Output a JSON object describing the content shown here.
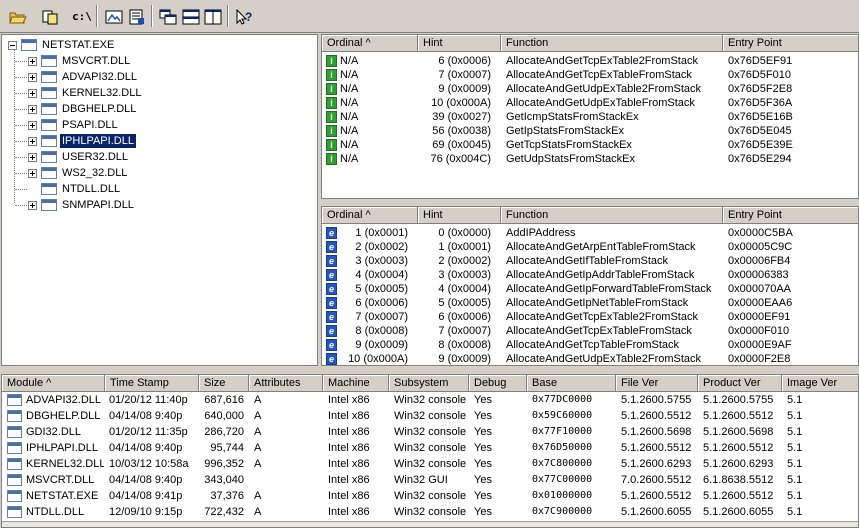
{
  "toolbar": {
    "buttons": [
      "open-icon",
      "copy-icon",
      "fullpath-icon",
      "undecorate-icon",
      "properties-icon",
      "cascade-icon",
      "tile-horizontal-icon",
      "tile-vertical-icon",
      "help-icon"
    ],
    "path_label": "c:\\"
  },
  "tree": {
    "root": "NETSTAT.EXE",
    "children": [
      {
        "label": "MSVCRT.DLL",
        "expandable": true,
        "selected": false
      },
      {
        "label": "ADVAPI32.DLL",
        "expandable": true,
        "selected": false
      },
      {
        "label": "KERNEL32.DLL",
        "expandable": true,
        "selected": false
      },
      {
        "label": "DBGHELP.DLL",
        "expandable": true,
        "selected": false
      },
      {
        "label": "PSAPI.DLL",
        "expandable": true,
        "selected": false
      },
      {
        "label": "IPHLPAPI.DLL",
        "expandable": true,
        "selected": true
      },
      {
        "label": "USER32.DLL",
        "expandable": true,
        "selected": false
      },
      {
        "label": "WS2_32.DLL",
        "expandable": true,
        "selected": false
      },
      {
        "label": "NTDLL.DLL",
        "expandable": false,
        "selected": false
      },
      {
        "label": "SNMPAPI.DLL",
        "expandable": true,
        "selected": false
      }
    ]
  },
  "imports": {
    "headers": [
      "Ordinal ^",
      "Hint",
      "Function",
      "Entry Point"
    ],
    "icon": "i",
    "rows": [
      {
        "ordinal": "N/A",
        "hint": "6  (0x0006)",
        "function": "AllocateAndGetTcpExTable2FromStack",
        "entry": "0x76D5EF91"
      },
      {
        "ordinal": "N/A",
        "hint": "7  (0x0007)",
        "function": "AllocateAndGetTcpExTableFromStack",
        "entry": "0x76D5F010"
      },
      {
        "ordinal": "N/A",
        "hint": "9  (0x0009)",
        "function": "AllocateAndGetUdpExTable2FromStack",
        "entry": "0x76D5F2E8"
      },
      {
        "ordinal": "N/A",
        "hint": "10  (0x000A)",
        "function": "AllocateAndGetUdpExTableFromStack",
        "entry": "0x76D5F36A"
      },
      {
        "ordinal": "N/A",
        "hint": "39  (0x0027)",
        "function": "GetIcmpStatsFromStackEx",
        "entry": "0x76D5E16B"
      },
      {
        "ordinal": "N/A",
        "hint": "56  (0x0038)",
        "function": "GetIpStatsFromStackEx",
        "entry": "0x76D5E045"
      },
      {
        "ordinal": "N/A",
        "hint": "69  (0x0045)",
        "function": "GetTcpStatsFromStackEx",
        "entry": "0x76D5E39E"
      },
      {
        "ordinal": "N/A",
        "hint": "76  (0x004C)",
        "function": "GetUdpStatsFromStackEx",
        "entry": "0x76D5E294"
      }
    ]
  },
  "exports": {
    "headers": [
      "Ordinal ^",
      "Hint",
      "Function",
      "Entry Point"
    ],
    "icon": "e",
    "rows": [
      {
        "ordinal": "1  (0x0001)",
        "hint": "0  (0x0000)",
        "function": "AddIPAddress",
        "entry": "0x0000C5BA"
      },
      {
        "ordinal": "2  (0x0002)",
        "hint": "1  (0x0001)",
        "function": "AllocateAndGetArpEntTableFromStack",
        "entry": "0x00005C9C"
      },
      {
        "ordinal": "3  (0x0003)",
        "hint": "2  (0x0002)",
        "function": "AllocateAndGetIfTableFromStack",
        "entry": "0x00006FB4"
      },
      {
        "ordinal": "4  (0x0004)",
        "hint": "3  (0x0003)",
        "function": "AllocateAndGetIpAddrTableFromStack",
        "entry": "0x00006383"
      },
      {
        "ordinal": "5  (0x0005)",
        "hint": "4  (0x0004)",
        "function": "AllocateAndGetIpForwardTableFromStack",
        "entry": "0x000070AA"
      },
      {
        "ordinal": "6  (0x0006)",
        "hint": "5  (0x0005)",
        "function": "AllocateAndGetIpNetTableFromStack",
        "entry": "0x0000EAA6"
      },
      {
        "ordinal": "7  (0x0007)",
        "hint": "6  (0x0006)",
        "function": "AllocateAndGetTcpExTable2FromStack",
        "entry": "0x0000EF91"
      },
      {
        "ordinal": "8  (0x0008)",
        "hint": "7  (0x0007)",
        "function": "AllocateAndGetTcpExTableFromStack",
        "entry": "0x0000F010"
      },
      {
        "ordinal": "9  (0x0009)",
        "hint": "8  (0x0008)",
        "function": "AllocateAndGetTcpTableFromStack",
        "entry": "0x0000E9AF"
      },
      {
        "ordinal": "10  (0x000A)",
        "hint": "9  (0x0009)",
        "function": "AllocateAndGetUdpExTable2FromStack",
        "entry": "0x0000F2E8"
      }
    ]
  },
  "modules": {
    "headers": [
      "Module ^",
      "Time Stamp",
      "Size",
      "Attributes",
      "Machine",
      "Subsystem",
      "Debug",
      "Base",
      "File Ver",
      "Product Ver",
      "Image Ver"
    ],
    "rows": [
      {
        "module": "ADVAPI32.DLL",
        "time": "01/20/12  11:40p",
        "size": "687,616",
        "attr": "A",
        "machine": "Intel x86",
        "subsystem": "Win32 console",
        "debug": "Yes",
        "base": "0x77DC0000",
        "filever": "5.1.2600.5755",
        "productver": "5.1.2600.5755",
        "imagever": "5.1"
      },
      {
        "module": "DBGHELP.DLL",
        "time": "04/14/08  9:40p",
        "size": "640,000",
        "attr": "A",
        "machine": "Intel x86",
        "subsystem": "Win32 console",
        "debug": "Yes",
        "base": "0x59C60000",
        "filever": "5.1.2600.5512",
        "productver": "5.1.2600.5512",
        "imagever": "5.1"
      },
      {
        "module": "GDI32.DLL",
        "time": "01/20/12  11:35p",
        "size": "286,720",
        "attr": "A",
        "machine": "Intel x86",
        "subsystem": "Win32 console",
        "debug": "Yes",
        "base": "0x77F10000",
        "filever": "5.1.2600.5698",
        "productver": "5.1.2600.5698",
        "imagever": "5.1"
      },
      {
        "module": "IPHLPAPI.DLL",
        "time": "04/14/08  9:40p",
        "size": "95,744",
        "attr": "A",
        "machine": "Intel x86",
        "subsystem": "Win32 console",
        "debug": "Yes",
        "base": "0x76D50000",
        "filever": "5.1.2600.5512",
        "productver": "5.1.2600.5512",
        "imagever": "5.1"
      },
      {
        "module": "KERNEL32.DLL",
        "time": "10/03/12  10:58a",
        "size": "996,352",
        "attr": "A",
        "machine": "Intel x86",
        "subsystem": "Win32 console",
        "debug": "Yes",
        "base": "0x7C800000",
        "filever": "5.1.2600.6293",
        "productver": "5.1.2600.6293",
        "imagever": "5.1"
      },
      {
        "module": "MSVCRT.DLL",
        "time": "04/14/08  9:40p",
        "size": "343,040",
        "attr": "",
        "machine": "Intel x86",
        "subsystem": "Win32 GUI",
        "debug": "Yes",
        "base": "0x77C00000",
        "filever": "7.0.2600.5512",
        "productver": "6.1.8638.5512",
        "imagever": "5.1"
      },
      {
        "module": "NETSTAT.EXE",
        "time": "04/14/08  9:41p",
        "size": "37,376",
        "attr": "A",
        "machine": "Intel x86",
        "subsystem": "Win32 console",
        "debug": "Yes",
        "base": "0x01000000",
        "filever": "5.1.2600.5512",
        "productver": "5.1.2600.5512",
        "imagever": "5.1"
      },
      {
        "module": "NTDLL.DLL",
        "time": "12/09/10  9:15p",
        "size": "722,432",
        "attr": "A",
        "machine": "Intel x86",
        "subsystem": "Win32 console",
        "debug": "Yes",
        "base": "0x7C900000",
        "filever": "5.1.2600.6055",
        "productver": "5.1.2600.6055",
        "imagever": "5.1"
      }
    ]
  }
}
